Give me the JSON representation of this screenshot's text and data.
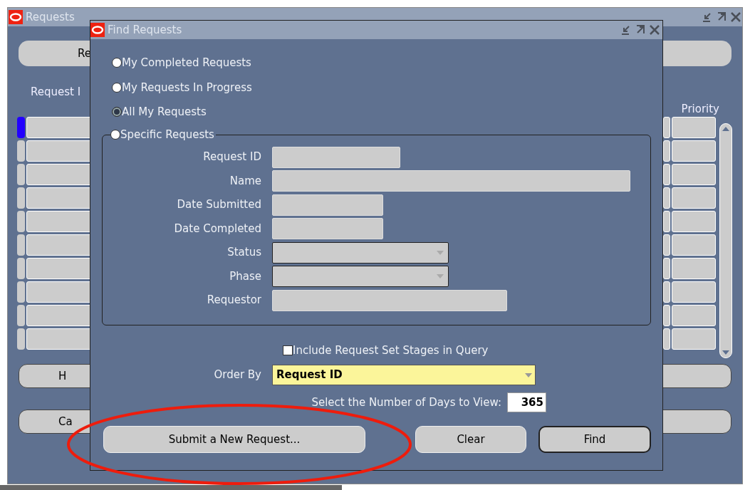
{
  "background_window": {
    "title": "Requests",
    "top_button": "Re",
    "columns": [
      "Request I",
      "Priority"
    ],
    "rows": [
      {
        "selected": true
      },
      {
        "selected": false
      },
      {
        "selected": false
      },
      {
        "selected": false
      },
      {
        "selected": false
      },
      {
        "selected": false
      },
      {
        "selected": false
      },
      {
        "selected": false
      },
      {
        "selected": false
      },
      {
        "selected": false
      }
    ],
    "buttons": [
      "H",
      "Ca"
    ]
  },
  "dialog": {
    "title": "Find Requests",
    "options": [
      {
        "label": "My Completed Requests",
        "selected": false
      },
      {
        "label": "My Requests In Progress",
        "selected": false
      },
      {
        "label": "All My Requests",
        "selected": true
      },
      {
        "label": "Specific Requests",
        "selected": false
      }
    ],
    "fields": [
      {
        "label": "Request ID",
        "kind": "text"
      },
      {
        "label": "Name",
        "kind": "text"
      },
      {
        "label": "Date Submitted",
        "kind": "text"
      },
      {
        "label": "Date Completed",
        "kind": "text"
      },
      {
        "label": "Status",
        "kind": "dropdown"
      },
      {
        "label": "Phase",
        "kind": "dropdown"
      },
      {
        "label": "Requestor",
        "kind": "text"
      }
    ],
    "include_stages": {
      "label": "Include Request Set Stages in Query",
      "checked": false
    },
    "order_by": {
      "label": "Order By",
      "value": "Request ID"
    },
    "days": {
      "label": "Select the Number of Days to View:",
      "value": "365"
    },
    "buttons": [
      {
        "label": "Submit a New Request...",
        "default": false
      },
      {
        "label": "Clear",
        "default": false
      },
      {
        "label": "Find",
        "default": true
      }
    ]
  }
}
